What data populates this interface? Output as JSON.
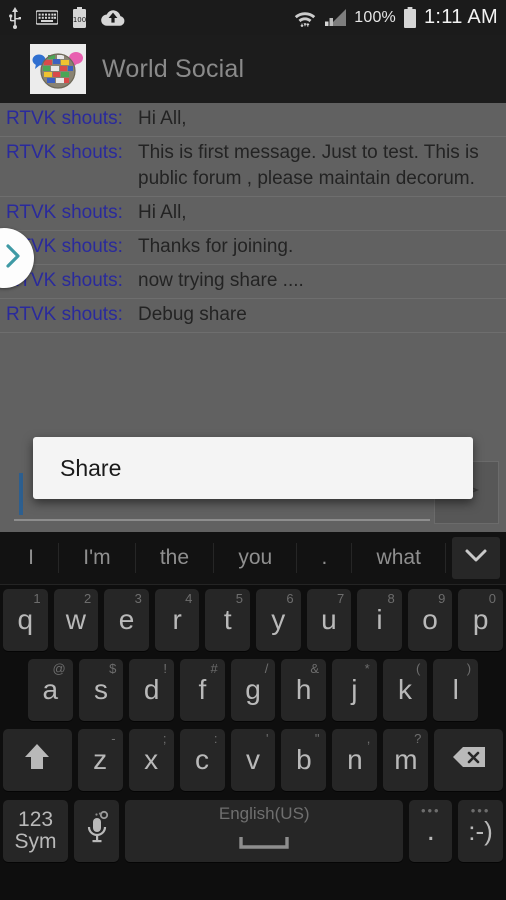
{
  "status_bar": {
    "left_icons": [
      "usb-icon",
      "keyboard-icon",
      "battery-saver-icon",
      "cloud-upload-icon"
    ],
    "right_icons": [
      "wifi-icon",
      "cellular-signal-icon",
      "battery-icon"
    ],
    "battery_percent": "100%",
    "time": "1:11 AM"
  },
  "app_bar": {
    "icon_name": "world-social-app-icon",
    "title": "World Social"
  },
  "messages": [
    {
      "user": "RTVK shouts:",
      "text": "Hi All,"
    },
    {
      "user": "RTVK shouts:",
      "text": "This is first message. Just to test. This is public forum , please maintain decorum."
    },
    {
      "user": "RTVK shouts:",
      "text": "Hi All,"
    },
    {
      "user": "RTVK shouts:",
      "text": "Thanks for joining."
    },
    {
      "user": "RTVK shouts:",
      "text": "now trying share ...."
    },
    {
      "user": "RTVK shouts:",
      "text": "Debug share"
    }
  ],
  "side_panel_handle": {
    "icon_name": "chevron-right-icon",
    "color": "#3f9aa5"
  },
  "composer": {
    "input_value": "",
    "placeholder": "",
    "send_icon_name": "send-triangle-icon"
  },
  "dialog": {
    "title": "Share"
  },
  "keyboard": {
    "suggestions": [
      "I",
      "I'm",
      "the",
      "you",
      ".",
      "what"
    ],
    "more_icon_name": "chevron-down-icon",
    "row1": [
      {
        "key": "q",
        "alt": "1"
      },
      {
        "key": "w",
        "alt": "2"
      },
      {
        "key": "e",
        "alt": "3"
      },
      {
        "key": "r",
        "alt": "4"
      },
      {
        "key": "t",
        "alt": "5"
      },
      {
        "key": "y",
        "alt": "6"
      },
      {
        "key": "u",
        "alt": "7"
      },
      {
        "key": "i",
        "alt": "8"
      },
      {
        "key": "o",
        "alt": "9"
      },
      {
        "key": "p",
        "alt": "0"
      }
    ],
    "row2": [
      {
        "key": "a",
        "alt": "@"
      },
      {
        "key": "s",
        "alt": "$"
      },
      {
        "key": "d",
        "alt": "!"
      },
      {
        "key": "f",
        "alt": "#"
      },
      {
        "key": "g",
        "alt": "/"
      },
      {
        "key": "h",
        "alt": "&"
      },
      {
        "key": "j",
        "alt": "*"
      },
      {
        "key": "k",
        "alt": "("
      },
      {
        "key": "l",
        "alt": ")"
      }
    ],
    "row3": [
      {
        "key": "z",
        "alt": "-"
      },
      {
        "key": "x",
        "alt": ";"
      },
      {
        "key": "c",
        "alt": ":"
      },
      {
        "key": "v",
        "alt": "'"
      },
      {
        "key": "b",
        "alt": "\""
      },
      {
        "key": "n",
        "alt": ","
      },
      {
        "key": "m",
        "alt": "?"
      }
    ],
    "shift_icon_name": "shift-arrow-icon",
    "backspace_icon_name": "backspace-icon",
    "symbols_label_top": "123",
    "symbols_label_bottom": "Sym",
    "mic_icon_name": "microphone-settings-icon",
    "space_label": "English(US)",
    "period_label": ".",
    "period_dots": "•••",
    "emoji_label": ":‑)",
    "emoji_dots": "•••"
  },
  "colors": {
    "dim_overlay": "#616161",
    "username": "#2a2a9c",
    "message_text": "#232323",
    "caret": "#2d5f8f",
    "dialog_bg": "#f4f4f4",
    "keyboard_bg": "#0e0e0e"
  }
}
